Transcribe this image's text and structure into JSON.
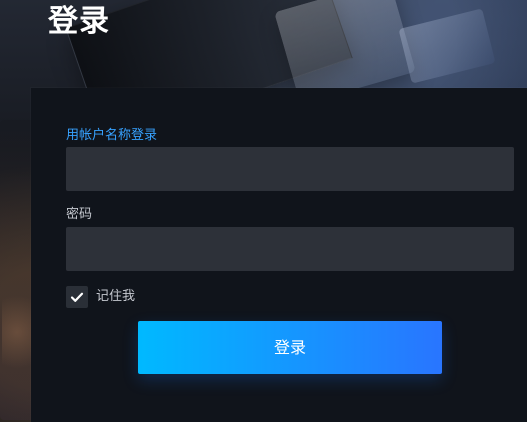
{
  "page": {
    "title": "登录"
  },
  "login_form": {
    "username_label": "用帐户名称登录",
    "username_value": "",
    "password_label": "密码",
    "password_value": "",
    "remember_label": "记住我",
    "remember_checked": true,
    "submit_label": "登录"
  },
  "icons": {
    "remember_checkbox": "checkmark-icon"
  },
  "colors": {
    "background_dark": "#10141b",
    "input_background": "#2d3139",
    "label_accent": "#37a2ff",
    "button_start": "#00b9ff",
    "button_end": "#2975ff",
    "title_text": "#ffffff"
  }
}
